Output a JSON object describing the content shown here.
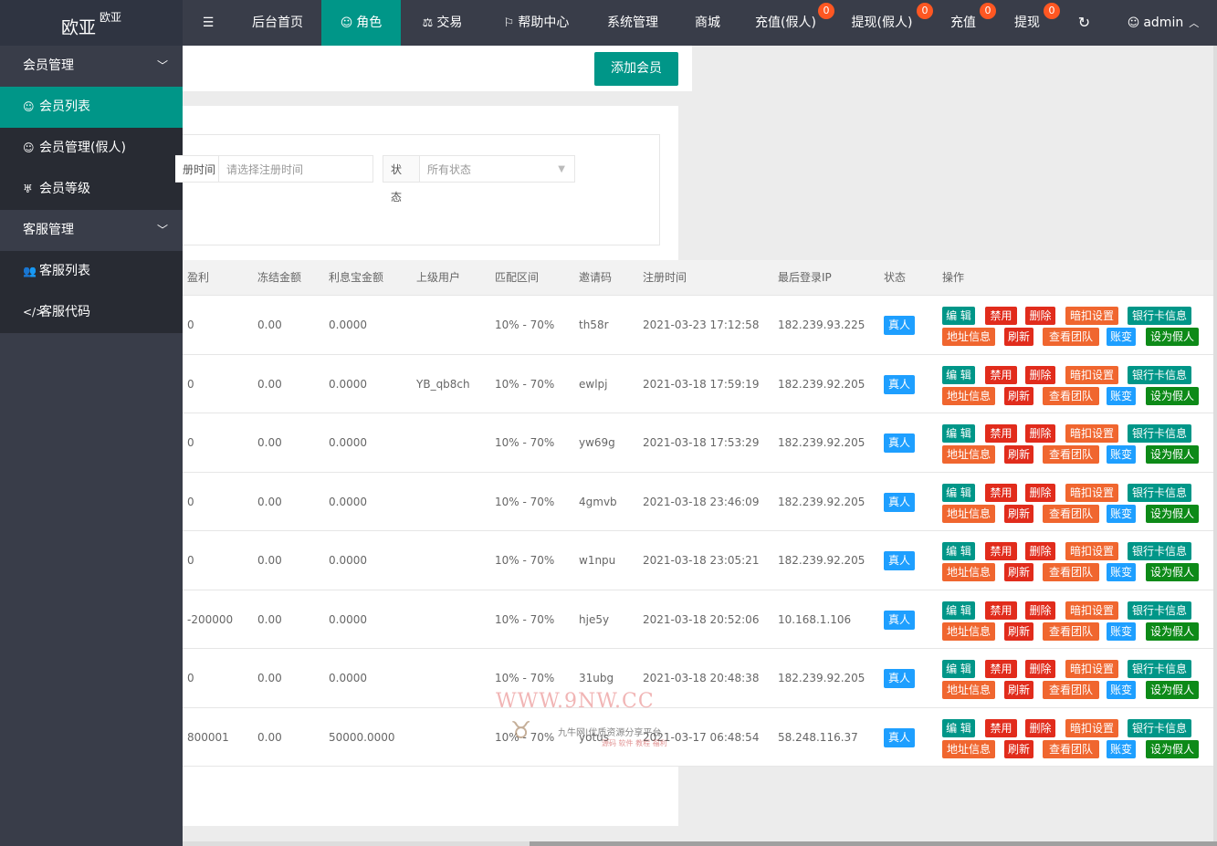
{
  "app": {
    "logo_main": "欧亚",
    "logo_sup": "欧亚"
  },
  "topnav": {
    "items": [
      {
        "label": "后台首页"
      },
      {
        "label": "角色"
      },
      {
        "label": "交易"
      },
      {
        "label": "帮助中心"
      },
      {
        "label": "系统管理"
      },
      {
        "label": "商城"
      },
      {
        "label": "充值(假人)",
        "badge": "0"
      },
      {
        "label": "提现(假人)",
        "badge": "0"
      },
      {
        "label": "充值",
        "badge": "0"
      },
      {
        "label": "提现",
        "badge": "0"
      }
    ],
    "user": "admin"
  },
  "sidebar": {
    "groups": [
      {
        "label": "会员管理",
        "items": [
          {
            "label": "会员列表"
          },
          {
            "label": "会员管理(假人)"
          },
          {
            "label": "会员等级"
          }
        ]
      },
      {
        "label": "客服管理",
        "items": [
          {
            "label": "客服列表"
          },
          {
            "label": "客服代码"
          }
        ]
      }
    ]
  },
  "toolbar": {
    "add_member": "添加会员"
  },
  "filter": {
    "reg_time_label": "册时间",
    "reg_time_placeholder": "请选择注册时间",
    "status_label": "状态",
    "status_value": "所有状态"
  },
  "table": {
    "headers": [
      "盈利",
      "冻结金额",
      "利息宝金额",
      "上级用户",
      "匹配区间",
      "邀请码",
      "注册时间",
      "最后登录IP",
      "状态",
      "操作"
    ],
    "ops": [
      "编 辑",
      "禁用",
      "删除",
      "暗扣设置",
      "银行卡信息",
      "地址信息",
      "刷新",
      "查看团队",
      "账变",
      "设为假人"
    ],
    "rows": [
      {
        "profit": "0",
        "frozen": "0.00",
        "interest": "0.0000",
        "parent": "",
        "range": "10% - 70%",
        "code": "th58r",
        "reg": "2021-03-23 17:12:58",
        "ip": "182.239.93.225",
        "status": "真人"
      },
      {
        "profit": "0",
        "frozen": "0.00",
        "interest": "0.0000",
        "parent": "YB_qb8ch",
        "range": "10% - 70%",
        "code": "ewlpj",
        "reg": "2021-03-18 17:59:19",
        "ip": "182.239.92.205",
        "status": "真人"
      },
      {
        "profit": "0",
        "frozen": "0.00",
        "interest": "0.0000",
        "parent": "",
        "range": "10% - 70%",
        "code": "yw69g",
        "reg": "2021-03-18 17:53:29",
        "ip": "182.239.92.205",
        "status": "真人"
      },
      {
        "profit": "0",
        "frozen": "0.00",
        "interest": "0.0000",
        "parent": "",
        "range": "10% - 70%",
        "code": "4gmvb",
        "reg": "2021-03-18 23:46:09",
        "ip": "182.239.92.205",
        "status": "真人"
      },
      {
        "profit": "0",
        "frozen": "0.00",
        "interest": "0.0000",
        "parent": "",
        "range": "10% - 70%",
        "code": "w1npu",
        "reg": "2021-03-18 23:05:21",
        "ip": "182.239.92.205",
        "status": "真人"
      },
      {
        "profit": "-200000",
        "frozen": "0.00",
        "interest": "0.0000",
        "parent": "",
        "range": "10% - 70%",
        "code": "hje5y",
        "reg": "2021-03-18 20:52:06",
        "ip": "10.168.1.106",
        "status": "真人"
      },
      {
        "profit": "0",
        "frozen": "0.00",
        "interest": "0.0000",
        "parent": "",
        "range": "10% - 70%",
        "code": "31ubg",
        "reg": "2021-03-18 20:48:38",
        "ip": "182.239.92.205",
        "status": "真人"
      },
      {
        "profit": "800001",
        "frozen": "0.00",
        "interest": "50000.0000",
        "parent": "",
        "range": "10% - 70%",
        "code": "yotus",
        "reg": "2021-03-17 06:48:54",
        "ip": "58.248.116.37",
        "status": "真人"
      }
    ]
  },
  "watermark": {
    "url": "WWW.9NW.CC",
    "line1": "九牛网|优质资源分享平台",
    "line2": "源码 软件 教程 福利"
  }
}
